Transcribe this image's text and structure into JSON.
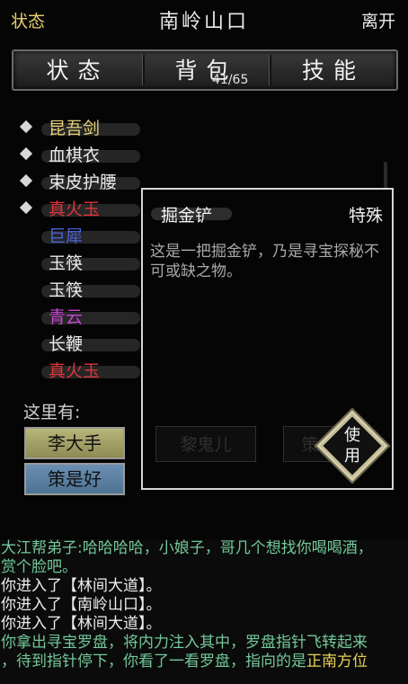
{
  "header": {
    "left_label": "状态",
    "title": "南岭山口",
    "right_label": "离开"
  },
  "tabs": [
    {
      "label": "状态"
    },
    {
      "label": "背包"
    },
    {
      "label": "技能"
    }
  ],
  "bag_count": "41/65",
  "items": [
    {
      "name": "昆吾剑",
      "color": "#e6d27a",
      "bullet": true
    },
    {
      "name": "血棋衣",
      "color": "#ebebeb",
      "bullet": true
    },
    {
      "name": "束皮护腰",
      "color": "#ebebeb",
      "bullet": true
    },
    {
      "name": "真火玉",
      "color": "#e0353a",
      "bullet": true
    },
    {
      "name": "巨犀",
      "color": "#4a63d6",
      "bullet": false
    },
    {
      "name": "玉筷",
      "color": "#ebebeb",
      "bullet": false
    },
    {
      "name": "玉筷",
      "color": "#ebebeb",
      "bullet": false
    },
    {
      "name": "青云",
      "color": "#c346cf",
      "bullet": false
    },
    {
      "name": "长鞭",
      "color": "#ebebeb",
      "bullet": false
    },
    {
      "name": "真火玉",
      "color": "#e0353a",
      "bullet": false
    }
  ],
  "here": {
    "label": "这里有:",
    "npcs": [
      "李大手",
      "策是好"
    ]
  },
  "popup": {
    "item_name": "掘金铲",
    "item_type": "特殊",
    "description": "这是一把掘金铲，乃是寻宝探秘不可或缺之物。",
    "dim_button_1": "黎鬼儿",
    "dim_button_2": "策",
    "use_label": "使用"
  },
  "log": {
    "speaker": "大江帮弟子",
    "speech": ":哈哈哈哈，小娘子，哥几个想找你喝喝酒，",
    "speech_cont": "赏个脸吧。",
    "lines": [
      "你进入了【林间大道】。",
      "你进入了【南岭山口】。",
      "你进入了【林间大道】。"
    ],
    "compass_1": "你拿出寻宝罗盘，将内力注入其中，罗盘指针飞转起来",
    "compass_2a": "，待到指针停下，你看了一看罗盘，指向的是",
    "compass_2b": "正南方位"
  }
}
